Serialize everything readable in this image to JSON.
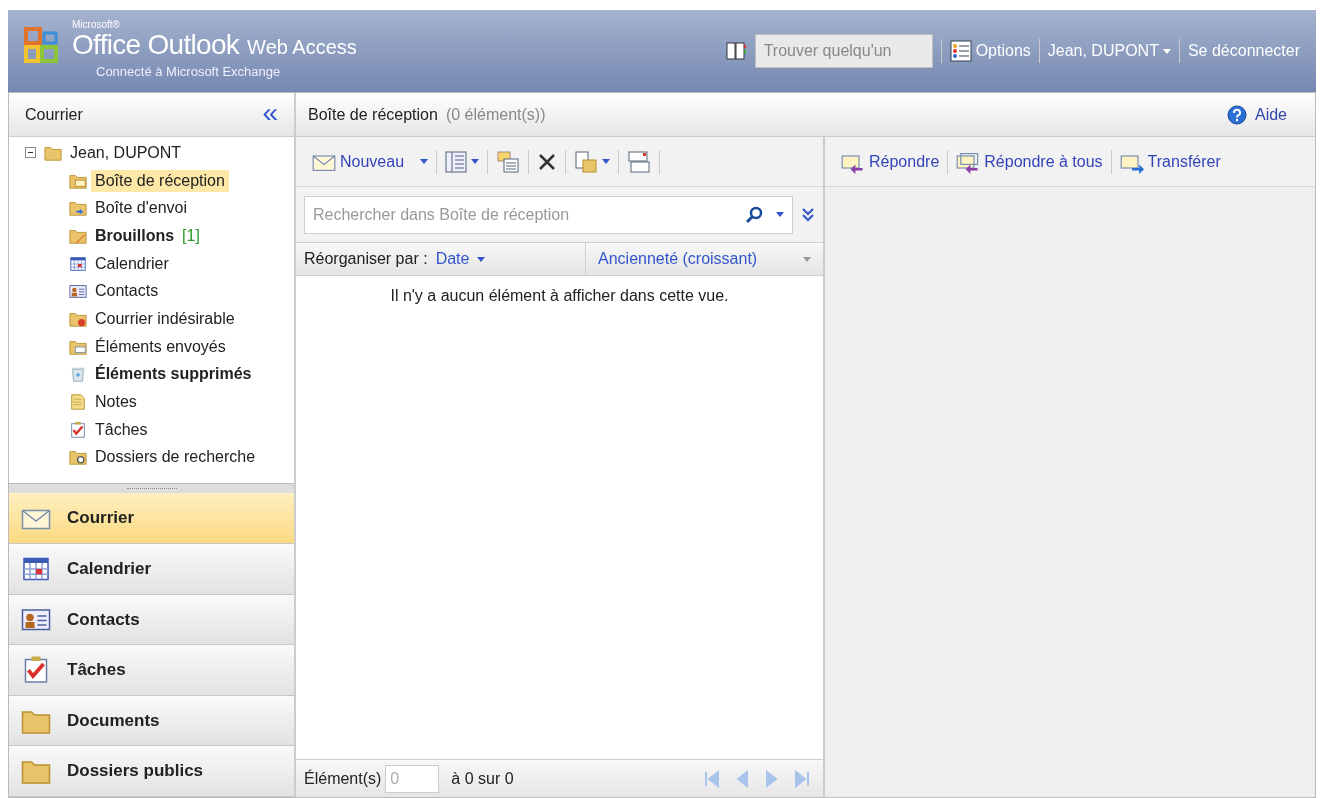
{
  "header": {
    "brand_small": "Microsoft®",
    "brand_main": "Office Outlook",
    "brand_suffix": "Web Access",
    "subtitle": "Connecté à Microsoft Exchange",
    "people_search": {
      "placeholder": "Trouver quelqu'un"
    },
    "options": "Options",
    "user": "Jean, DUPONT",
    "logout": "Se déconnecter"
  },
  "sidebar": {
    "title": "Courrier",
    "collapse": "«",
    "tree": [
      {
        "label": "Jean, DUPONT",
        "kind": "mailbox",
        "expanded": true,
        "selected": false,
        "bold": false,
        "children": [
          {
            "label": "Boîte de réception",
            "kind": "inbox",
            "selected": true,
            "bold": false
          },
          {
            "label": "Boîte d'envoi",
            "kind": "outbox",
            "selected": false,
            "bold": false
          },
          {
            "label": "Brouillons",
            "kind": "drafts",
            "selected": false,
            "bold": true,
            "count": "[1]"
          },
          {
            "label": "Calendrier",
            "kind": "calendar",
            "selected": false,
            "bold": false
          },
          {
            "label": "Contacts",
            "kind": "contacts",
            "selected": false,
            "bold": false
          },
          {
            "label": "Courrier indésirable",
            "kind": "junk",
            "selected": false,
            "bold": false
          },
          {
            "label": "Éléments envoyés",
            "kind": "sent",
            "selected": false,
            "bold": false
          },
          {
            "label": "Éléments supprimés",
            "kind": "trash",
            "selected": false,
            "bold": true
          },
          {
            "label": "Notes",
            "kind": "notes",
            "selected": false,
            "bold": false
          },
          {
            "label": "Tâches",
            "kind": "tasks",
            "selected": false,
            "bold": false
          },
          {
            "label": "Dossiers de recherche",
            "kind": "search",
            "selected": false,
            "bold": false
          }
        ]
      }
    ],
    "nav": [
      {
        "label": "Courrier",
        "kind": "mail",
        "selected": true
      },
      {
        "label": "Calendrier",
        "kind": "calendar",
        "selected": false
      },
      {
        "label": "Contacts",
        "kind": "contacts",
        "selected": false
      },
      {
        "label": "Tâches",
        "kind": "tasks",
        "selected": false
      },
      {
        "label": "Documents",
        "kind": "documents",
        "selected": false
      },
      {
        "label": "Dossiers publics",
        "kind": "public",
        "selected": false
      }
    ]
  },
  "list": {
    "title": "Boîte de réception",
    "count": "(0 élément(s))",
    "new_button": "Nouveau",
    "search": {
      "placeholder": "Rechercher dans Boîte de réception"
    },
    "sort_label": "Réorganiser par :",
    "sort_field": "Date",
    "sort_order": "Ancienneté (croissant)",
    "empty": "Il n'y a aucun élément à afficher dans cette vue.",
    "pager": {
      "label": "Élément(s)",
      "page": {
        "placeholder": "0"
      },
      "range": "à 0 sur 0"
    }
  },
  "reading": {
    "help": "Aide",
    "actions": [
      {
        "label": "Répondre",
        "kind": "reply"
      },
      {
        "label": "Répondre à tous",
        "kind": "reply_all"
      },
      {
        "label": "Transférer",
        "kind": "forward"
      }
    ]
  }
}
